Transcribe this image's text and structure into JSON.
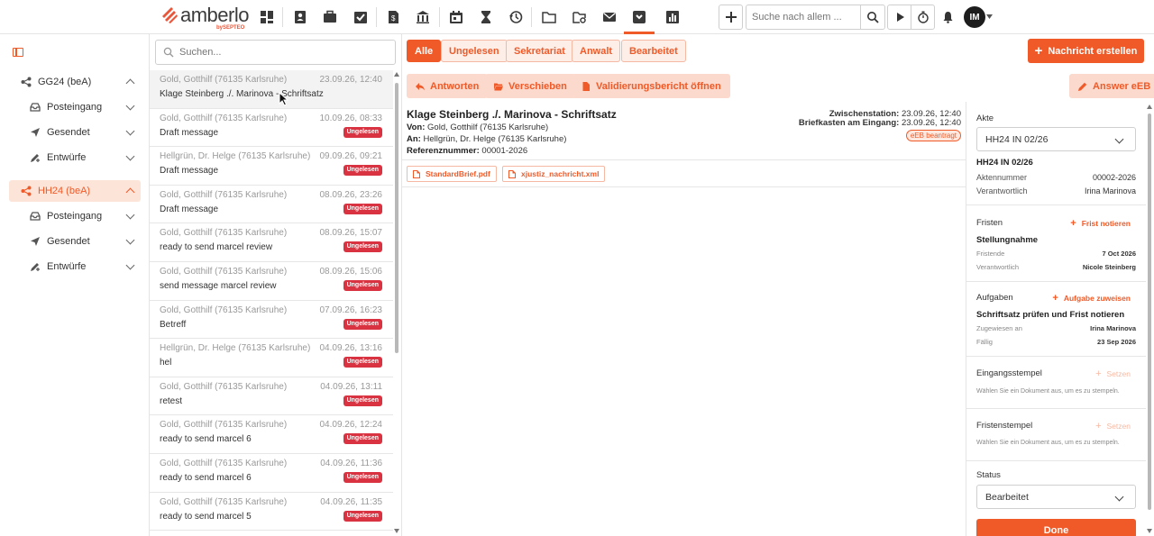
{
  "brand": {
    "name": "amberlo",
    "by": "bySEPTEO"
  },
  "topbar": {
    "search_placeholder": "Suche nach allem ...",
    "avatar_initials": "IM",
    "nav_icons": [
      "dashboard-icon",
      "contacts-icon",
      "briefcase-icon",
      "tasks-icon",
      "invoice-icon",
      "bank-icon",
      "calendar-icon",
      "hourglass-icon",
      "history-icon",
      "folder-icon",
      "folder-search-icon",
      "mail-icon",
      "bea-inbox-icon",
      "reports-icon"
    ]
  },
  "sidebar": {
    "groups": [
      {
        "label": "GG24 (beA)",
        "active": false,
        "items": [
          {
            "label": "Posteingang"
          },
          {
            "label": "Gesendet"
          },
          {
            "label": "Entwürfe"
          }
        ]
      },
      {
        "label": "HH24 (beA)",
        "active": true,
        "items": [
          {
            "label": "Posteingang"
          },
          {
            "label": "Gesendet"
          },
          {
            "label": "Entwürfe"
          }
        ]
      }
    ]
  },
  "messages": {
    "search_placeholder": "Suchen...",
    "items": [
      {
        "from": "Gold, Gotthilf (76135 Karlsruhe)",
        "date": "23.09.26, 12:40",
        "subject": "Klage Steinberg ./. Marinova - Schriftsatz",
        "badge": ""
      },
      {
        "from": "Gold, Gotthilf (76135 Karlsruhe)",
        "date": "10.09.26, 08:33",
        "subject": "Draft message",
        "badge": "Ungelesen"
      },
      {
        "from": "Hellgrün, Dr. Helge (76135 Karlsruhe)",
        "date": "09.09.26, 09:21",
        "subject": "Draft message",
        "badge": "Ungelesen"
      },
      {
        "from": "Gold, Gotthilf (76135 Karlsruhe)",
        "date": "08.09.26, 23:26",
        "subject": "Draft message",
        "badge": "Ungelesen"
      },
      {
        "from": "Gold, Gotthilf (76135 Karlsruhe)",
        "date": "08.09.26, 15:07",
        "subject": "ready to send marcel review",
        "badge": "Ungelesen"
      },
      {
        "from": "Gold, Gotthilf (76135 Karlsruhe)",
        "date": "08.09.26, 15:06",
        "subject": "send message marcel review",
        "badge": "Ungelesen"
      },
      {
        "from": "Gold, Gotthilf (76135 Karlsruhe)",
        "date": "07.09.26, 16:23",
        "subject": "Betreff",
        "badge": "Ungelesen"
      },
      {
        "from": "Hellgrün, Dr. Helge (76135 Karlsruhe)",
        "date": "04.09.26, 13:16",
        "subject": "hel",
        "badge": "Ungelesen"
      },
      {
        "from": "Gold, Gotthilf (76135 Karlsruhe)",
        "date": "04.09.26, 13:11",
        "subject": "retest",
        "badge": "Ungelesen"
      },
      {
        "from": "Gold, Gotthilf (76135 Karlsruhe)",
        "date": "04.09.26, 12:24",
        "subject": "ready to send marcel 6",
        "badge": "Ungelesen"
      },
      {
        "from": "Gold, Gotthilf (76135 Karlsruhe)",
        "date": "04.09.26, 11:36",
        "subject": "ready to send marcel 6",
        "badge": "Ungelesen"
      },
      {
        "from": "Gold, Gotthilf (76135 Karlsruhe)",
        "date": "04.09.26, 11:35",
        "subject": "ready to send marcel 5",
        "badge": "Ungelesen"
      }
    ]
  },
  "filters": {
    "all": "Alle",
    "unread": "Ungelesen",
    "secretariat": "Sekretariat",
    "lawyer": "Anwalt",
    "edited": "Bearbeitet"
  },
  "create_button": "Nachricht erstellen",
  "actions": {
    "reply": "Antworten",
    "move": "Verschieben",
    "validation": "Validierungsbericht öffnen",
    "answer_eeb": "Answer eEB"
  },
  "detail": {
    "title": "Klage Steinberg ./. Marinova - Schriftsatz",
    "from_label": "Von:",
    "from": "Gold, Gotthilf (76135 Karlsruhe)",
    "to_label": "An:",
    "to": "Hellgrün, Dr. Helge (76135 Karlsruhe)",
    "ref_label": "Referenznummer:",
    "ref": "00001-2026",
    "relay_label": "Zwischenstation:",
    "relay": "23.09.26, 12:40",
    "mailbox_label": "Briefkasten am Eingang:",
    "mailbox": "23.09.26, 12:40",
    "eeb_badge": "eEB beantragt",
    "attachments": [
      "StandardBrief.pdf",
      "xjustiz_nachricht.xml"
    ]
  },
  "right_panel": {
    "akte_label": "Akte",
    "akte_value": "HH24 IN 02/26",
    "akte_title": "HH24 IN 02/26",
    "aktennummer_label": "Aktennummer",
    "aktennummer": "00002-2026",
    "verantwortlich_label": "Verantwortlich",
    "verantwortlich": "Irina Marinova",
    "fristen_label": "Fristen",
    "frist_link": "Frist notieren",
    "frist_title": "Stellungnahme",
    "fristende_label": "Fristende",
    "fristende": "7 Oct 2026",
    "frist_verantw_label": "Verantwortlich",
    "frist_verantw": "Nicole Steinberg",
    "aufgaben_label": "Aufgaben",
    "aufgabe_link": "Aufgabe zuweisen",
    "aufgabe_title": "Schriftsatz prüfen und Frist notieren",
    "zugewiesen_label": "Zugewiesen an",
    "zugewiesen": "Irina Marinova",
    "faellig_label": "Fällig",
    "faellig": "23 Sep 2026",
    "eingang_label": "Eingangsstempel",
    "set_label": "Setzen",
    "eingang_hint": "Wählen Sie ein Dokument aus, um es zu stempeln.",
    "fristen_stempel_label": "Fristenstempel",
    "fristen_hint": "Wählen Sie ein Dokument aus, um es zu stempeln.",
    "status_label": "Status",
    "status_value": "Bearbeitet",
    "done_button": "Done"
  },
  "colors": {
    "accent": "#f05a28",
    "badge": "#d93240"
  }
}
